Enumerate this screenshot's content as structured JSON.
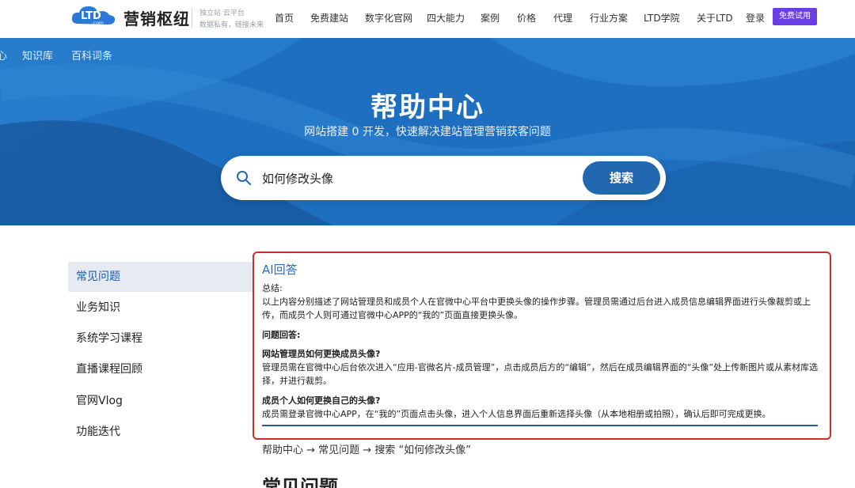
{
  "header": {
    "logo_badge": "LTD",
    "logo_badge_sub": ".com",
    "logo_name": "营销枢纽",
    "tagline_1": "独立站 云平台",
    "tagline_2": "数据私有，链接未来",
    "nav": [
      "首页",
      "免费建站",
      "数字化官网",
      "四大能力",
      "案例",
      "价格",
      "代理",
      "行业方案",
      "LTD学院",
      "关于LTD",
      "登录"
    ],
    "trial_label": "免费试用"
  },
  "hero": {
    "sublinks": [
      "心",
      "知识库",
      "百科词条"
    ],
    "title": "帮助中心",
    "subtitle": "网站搭建 0 开发，快速解决建站管理营销获客问题",
    "search": {
      "value": "如何修改头像",
      "button_label": "搜索"
    }
  },
  "sidebar": {
    "items": [
      {
        "label": "常见问题",
        "active": true
      },
      {
        "label": "业务知识",
        "active": false
      },
      {
        "label": "系统学习课程",
        "active": false
      },
      {
        "label": "直播课程回顾",
        "active": false
      },
      {
        "label": "官网Vlog",
        "active": false
      },
      {
        "label": "功能迭代",
        "active": false
      }
    ]
  },
  "ai_answer": {
    "title": "AI回答",
    "summary_label": "总结:",
    "summary": "以上内容分别描述了网站管理员和成员个人在官微中心平台中更换头像的操作步骤。管理员需通过后台进入成员信息编辑界面进行头像裁剪或上传，而成员个人则可通过官微中心APP的“我的”页面直接更换头像。",
    "qa_label": "问题回答:",
    "q1": "网站管理员如何更换成员头像?",
    "a1": "管理员需在官微中心后台依次进入“应用-官微名片-成员管理”，点击成员后方的“编辑”，然后在成员编辑界面的“头像”处上传新图片或从素材库选择，并进行裁剪。",
    "q2": "成员个人如何更换自己的头像?",
    "a2": "成员需登录官微中心APP，在“我的”页面点击头像，进入个人信息界面后重新选择头像（从本地相册或拍照），确认后即可完成更换。"
  },
  "breadcrumb": "帮助中心 → 常见问题 → 搜索 “如何修改头像”",
  "section_title": "常见问题",
  "colors": {
    "hero_blue": "#1e6fc0",
    "search_button": "#2268b0",
    "trial_button": "#6a3ee6",
    "ai_border": "#c9302c",
    "ai_title": "#2a6cc2"
  }
}
